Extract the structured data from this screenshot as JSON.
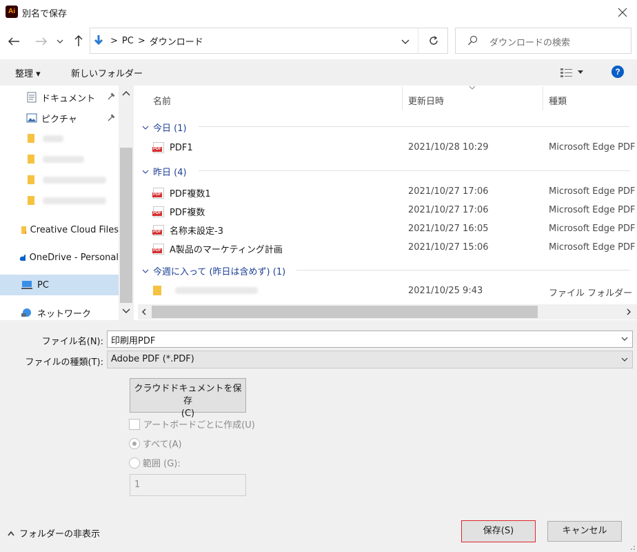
{
  "window": {
    "title": "別名で保存",
    "app_icon_text": "Ai"
  },
  "address": {
    "crumbs": [
      "PC",
      "ダウンロード"
    ],
    "separator": ">"
  },
  "search": {
    "placeholder": "ダウンロードの検索"
  },
  "toolbar": {
    "organize_label": "整理 ▾",
    "new_folder_label": "新しいフォルダー",
    "help_label": "?"
  },
  "navpane": {
    "items": [
      {
        "label": "ドキュメント",
        "icon": "document-icon",
        "pinned": true
      },
      {
        "label": "ピクチャ",
        "icon": "pictures-icon",
        "pinned": true
      },
      {
        "label": "Creative Cloud Files",
        "icon": "creative-cloud-folder-icon"
      },
      {
        "label": "OneDrive - Personal",
        "icon": "onedrive-icon"
      },
      {
        "label": "PC",
        "icon": "pc-icon",
        "selected": true
      },
      {
        "label": "ネットワーク",
        "icon": "network-icon"
      }
    ]
  },
  "columns": {
    "name": "名前",
    "date": "更新日時",
    "type": "種類"
  },
  "groups": [
    {
      "header": "今日 (1)",
      "files": [
        {
          "name": "PDF1",
          "date": "2021/10/28 10:29",
          "type": "Microsoft Edge PDF"
        }
      ]
    },
    {
      "header": "昨日 (4)",
      "files": [
        {
          "name": "PDF複数1",
          "date": "2021/10/27 17:06",
          "type": "Microsoft Edge PDF"
        },
        {
          "name": "PDF複数",
          "date": "2021/10/27 17:06",
          "type": "Microsoft Edge PDF"
        },
        {
          "name": "名称未設定-3",
          "date": "2021/10/27 16:05",
          "type": "Microsoft Edge PDF"
        },
        {
          "name": "A製品のマーケティング計画",
          "date": "2021/10/27 15:06",
          "type": "Microsoft Edge PDF"
        }
      ]
    },
    {
      "header": "今週に入って (昨日は含めず) (1)",
      "files": [
        {
          "name": "",
          "date": "2021/10/25 9:43",
          "type": "ファイル フォルダー"
        }
      ]
    }
  ],
  "form": {
    "filename_label": "ファイル名(N):",
    "filename_value": "印刷用PDF",
    "filetype_label": "ファイルの種類(T):",
    "filetype_value": "Adobe PDF (*.PDF)",
    "cloud_button_line1": "クラウドドキュメントを保存",
    "cloud_button_line2": "(C)",
    "artboard_label": "アートボードごとに作成(U)",
    "radio_all_label": "すべて(A)",
    "radio_range_label": "範囲 (G):",
    "range_value": "1"
  },
  "footer": {
    "hide_folders_label": "フォルダーの非表示",
    "save_label": "保存(S)",
    "cancel_label": "キャンセル"
  },
  "colors": {
    "selection": "#cce0f4",
    "group_header": "#1c3f94",
    "save_highlight": "#e0242b",
    "help_blue": "#0a5ec7"
  }
}
